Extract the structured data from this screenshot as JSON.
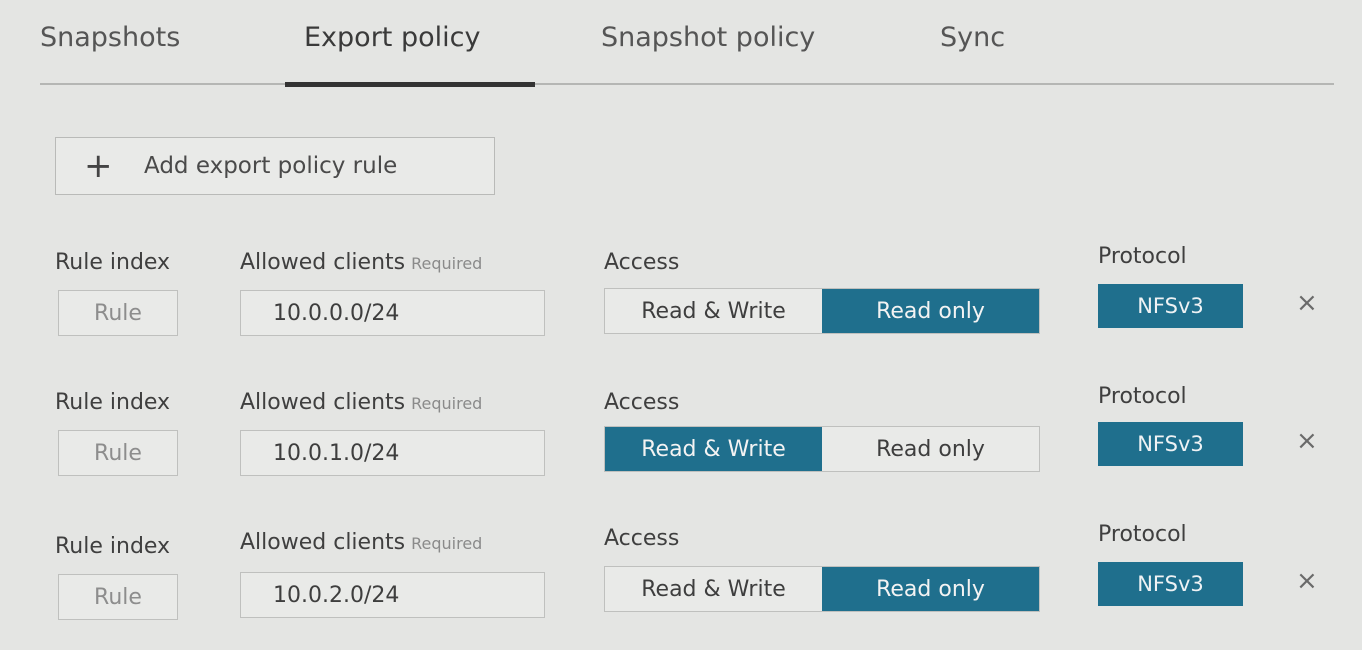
{
  "tabs": [
    {
      "label": "Snapshots"
    },
    {
      "label": "Export policy"
    },
    {
      "label": "Snapshot policy"
    },
    {
      "label": "Sync"
    }
  ],
  "active_tab": "Export policy",
  "add_button": {
    "icon": "+",
    "label": "Add export policy rule"
  },
  "labels": {
    "rule_index": "Rule index",
    "allowed_clients": "Allowed clients",
    "required": "Required",
    "access": "Access",
    "protocol": "Protocol"
  },
  "rules": [
    {
      "index_placeholder": "Rule",
      "allowed_clients": "10.0.0.0/24",
      "access_options": [
        "Read & Write",
        "Read only"
      ],
      "access_selected": "Read only",
      "protocol": "NFSv3",
      "remove_icon": "×"
    },
    {
      "index_placeholder": "Rule",
      "allowed_clients": "10.0.1.0/24",
      "access_options": [
        "Read & Write",
        "Read only"
      ],
      "access_selected": "Read & Write",
      "protocol": "NFSv3",
      "remove_icon": "×"
    },
    {
      "index_placeholder": "Rule",
      "allowed_clients": "10.0.2.0/24",
      "access_options": [
        "Read & Write",
        "Read only"
      ],
      "access_selected": "Read only",
      "protocol": "NFSv3",
      "remove_icon": "×"
    }
  ],
  "colors": {
    "accent": "#1f6f8d",
    "background": "#e4e5e3"
  }
}
